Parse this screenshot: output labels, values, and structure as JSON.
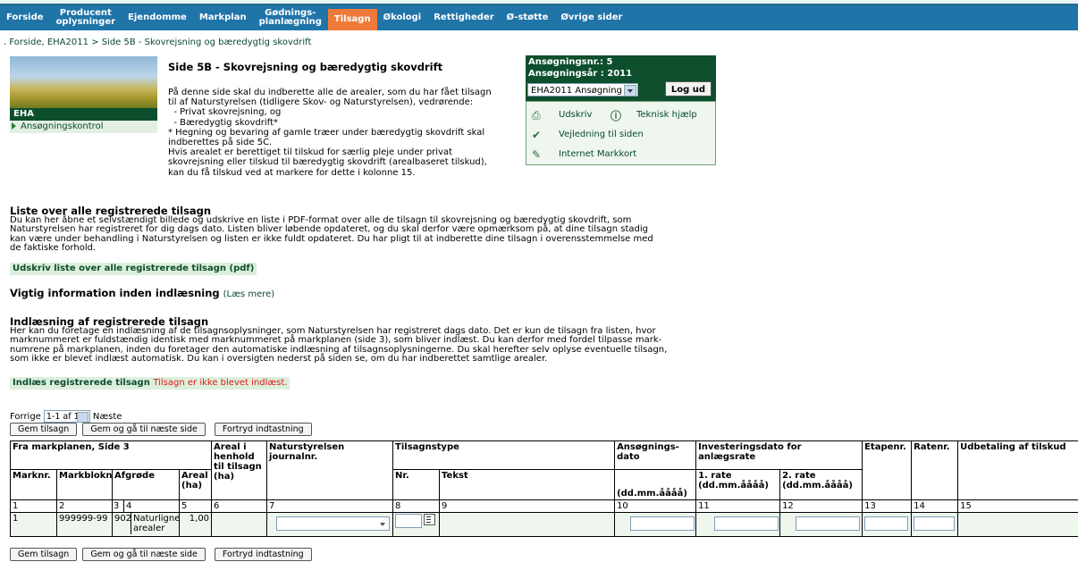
{
  "nav": [
    {
      "label": "Forside",
      "active": false
    },
    {
      "label": "Producent\noplysninger",
      "active": false
    },
    {
      "label": "Ejendomme",
      "active": false
    },
    {
      "label": "Markplan",
      "active": false
    },
    {
      "label": "Gødnings-\nplanlægning",
      "active": false
    },
    {
      "label": "Tilsagn",
      "active": true
    },
    {
      "label": "Økologi",
      "active": false
    },
    {
      "label": "Rettigheder",
      "active": false
    },
    {
      "label": "Ø-støtte",
      "active": false
    },
    {
      "label": "Øvrige sider",
      "active": false
    }
  ],
  "breadcrumb": ". Forside, EHA2011 > Side 5B - Skovrejsning og bæredygtig skovdrift",
  "sidebar": {
    "title": "EHA",
    "item": "Ansøgningskontrol"
  },
  "page_title": "Side 5B - Skovrejsning og bæredygtig skovdrift",
  "intro_lines": [
    "På denne side skal du indberette alle de arealer, som du har fået tilsagn",
    "til af Naturstyrelsen (tidligere Skov- og Naturstyrelsen), vedrørende:",
    "  - Privat skovrejsning, og",
    "  - Bæredygtig skovdrift*",
    "* Hegning og bevaring af gamle træer under bæredygtig skovdrift skal",
    "indberettes på side 5C.",
    "Hvis arealet er berettiget til tilskud for særlig pleje under privat",
    "skovrejsning eller tilskud til bæredygtig skovdrift (arealbaseret tilskud),",
    "kan du få tilskud ved at markere for dette i kolonne 15."
  ],
  "application": {
    "nr_label": "Ansøgningsnr.: 5",
    "year_label": "Ansøgningsår : 2011",
    "select_value": "EHA2011 Ansøgning",
    "logout": "Log ud"
  },
  "links": {
    "print": "Udskriv",
    "help": "Teknisk hjælp",
    "guide": "Vejledning til siden",
    "map": "Internet Markkort"
  },
  "list_section": {
    "title": "Liste over alle registrerede tilsagn",
    "lines": [
      "Du kan her åbne et selvstændigt billede og udskrive en liste i PDF-format over alle de tilsagn til skovrejsning og bæredygtig skovdrift, som",
      "Naturstyrelsen har registreret for dig dags dato. Listen bliver løbende opdateret, og du skal derfor være opmærksom på, at dine tilsagn stadig",
      "kan være under behandling i Naturstyrelsen og listen er ikke fuldt opdateret. Du har pligt til at indberette dine tilsagn i overensstemmelse med",
      "de faktiske forhold."
    ],
    "button": "Udskriv liste over alle registrerede tilsagn (pdf)"
  },
  "important": {
    "title": "Vigtig information inden indlæsning",
    "more": "(Læs mere)"
  },
  "import_section": {
    "title": "Indlæsning af registrerede tilsagn",
    "lines": [
      "Her kan du foretage en indlæsning af de tilsagnsoplysninger, som Naturstyrelsen har registreret dags dato. Det er kun de tilsagn fra listen, hvor",
      "marknummeret er fuldstændig identisk med marknummeret på markplanen (side 3), som bliver indlæst. Du kan derfor med fordel tilpasse mark-",
      "numrene på markplanen, inden du foretager den automatiske indlæsning af tilsagnsoplysningerne. Du skal herefter selv oplyse eventuelle tilsagn,",
      "som ikke er blevet indlæst automatisk. Du kan i oversigten nederst på siden se, om du har indberettet samtlige arealer."
    ],
    "button": "Indlæs registrerede tilsagn",
    "status": "Tilsagn er ikke blevet indlæst."
  },
  "pager": {
    "prev": "Forrige",
    "value": "1-1 af 1",
    "next": "Næste"
  },
  "buttons": {
    "save": "Gem tilsagn",
    "save_next": "Gem og gå til næste side",
    "undo": "Fortryd indtastning"
  },
  "table": {
    "group1": "Fra markplanen, Side 3",
    "areal_henhold": "Areal i henhold til tilsagn (ha)",
    "journal": "Naturstyrelsen journalnr.",
    "tilsagnstype": "Tilsagnstype",
    "ansdato": "Ansøgnings- dato",
    "invest": "Investeringsdato for anlægsrate",
    "etape": "Etapenr.",
    "rate": "Ratenr.",
    "udbet": "Udbetaling af tilskud",
    "marknr": "Marknr.",
    "markblok": "Markbloknr.",
    "afgrode": "Afgrøde",
    "areal": "Areal (ha)",
    "nr": "Nr.",
    "tekst": "Tekst",
    "datefmt": "(dd.mm.åååå)",
    "rate1": "1. rate (dd.mm.åååå)",
    "rate2": "2. rate (dd.mm.åååå)",
    "colnums": [
      "1",
      "2",
      "3",
      "4",
      "5",
      "6",
      "7",
      "8",
      "9",
      "10",
      "11",
      "12",
      "13",
      "14",
      "15"
    ],
    "row": {
      "marknr": "1",
      "markblok": "999999-99",
      "afgrode_code": "902",
      "afgrode": "Naturlignende arealer",
      "areal": "1,00"
    }
  }
}
